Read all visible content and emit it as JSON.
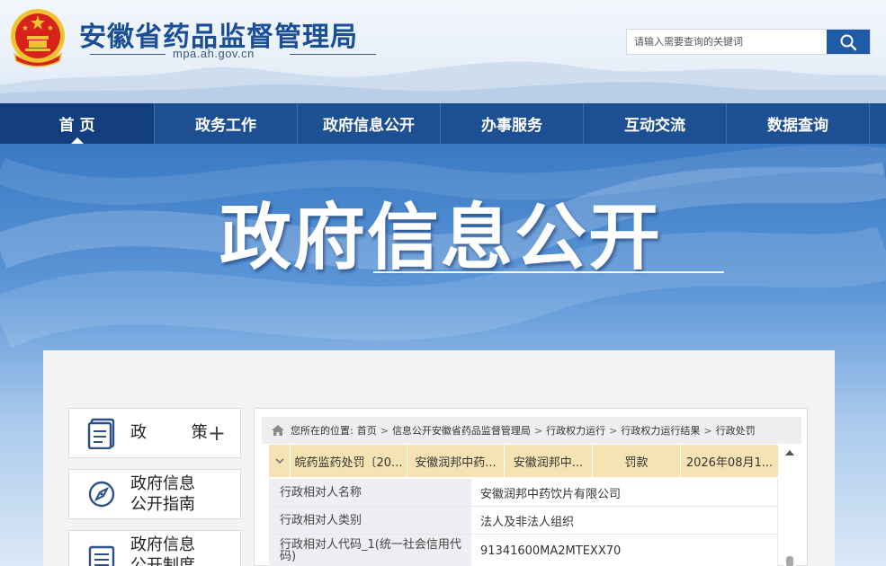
{
  "header": {
    "site_title": "安徽省药品监督管理局",
    "site_domain": "mpa.ah.gov.cn",
    "emblem_icon": "national-emblem-icon",
    "search": {
      "placeholder": "请输入需要查询的关键词",
      "value": "",
      "button_icon": "search-icon"
    }
  },
  "nav": {
    "items": [
      {
        "label": "首 页",
        "active": true
      },
      {
        "label": "政务工作",
        "active": false
      },
      {
        "label": "政府信息公开",
        "active": false
      },
      {
        "label": "办事服务",
        "active": false
      },
      {
        "label": "互动交流",
        "active": false
      },
      {
        "label": "数据查询",
        "active": false
      }
    ]
  },
  "banner": {
    "title": "政府信息公开"
  },
  "sidebar": {
    "items": [
      {
        "label": "政 策",
        "icon": "policy-book-icon",
        "expand_icon": "plus-icon"
      },
      {
        "label_line1": "政府信息",
        "label_line2": "公开指南",
        "icon": "compass-icon"
      },
      {
        "label_line1": "政府信息",
        "label_line2": "公开制度",
        "icon": "document-list-icon"
      }
    ]
  },
  "breadcrumb": {
    "home_icon": "home-icon",
    "prefix": "您所在的位置:",
    "items": [
      "首页",
      "信息公开安徽省药品监督管理局",
      "行政权力运行",
      "行政权力运行结果",
      "行政处罚"
    ],
    "separator": ">"
  },
  "record": {
    "toggle_icon": "chevron-down-icon",
    "summary": [
      "皖药监药处罚〔20...",
      "安徽润邦中药...",
      "安徽润邦中...",
      "罚款",
      "2026年08月1..."
    ],
    "details": [
      {
        "key": "行政相对人名称",
        "value": "安徽润邦中药饮片有限公司"
      },
      {
        "key": "行政相对人类别",
        "value": "法人及非法人组织"
      },
      {
        "key": "行政相对人代码_1(统一社会信用代码)",
        "value": "91341600MA2MTEXX70"
      }
    ]
  },
  "colors": {
    "brand_blue": "#1d4f93",
    "summary_row": "#f6e3b4",
    "emblem_red": "#d8231c",
    "emblem_gold": "#f2c230"
  }
}
